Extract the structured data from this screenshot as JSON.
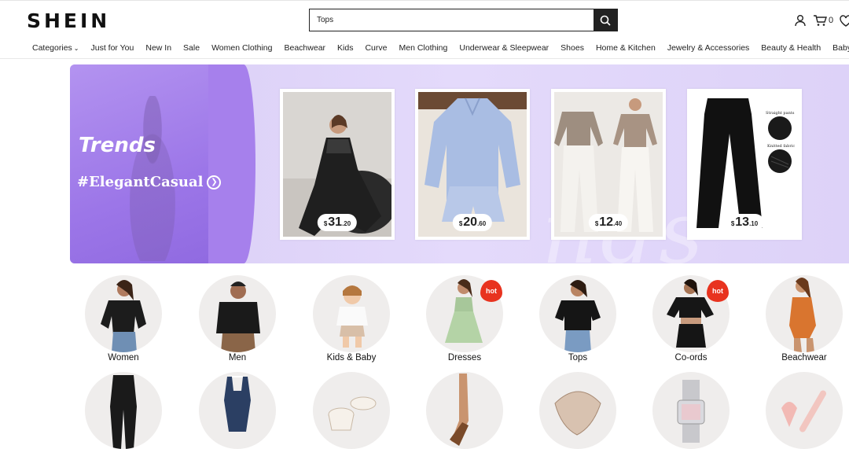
{
  "brand": {
    "logo": "SHEIN"
  },
  "search": {
    "value": "Tops"
  },
  "header": {
    "cart_count": "0"
  },
  "nav": {
    "items": [
      "Categories",
      "Just for You",
      "New In",
      "Sale",
      "Women Clothing",
      "Beachwear",
      "Kids",
      "Curve",
      "Men Clothing",
      "Underwear & Sleepwear",
      "Shoes",
      "Home & Kitchen",
      "Jewelry & Accessories",
      "Beauty & Health",
      "Baby & Matern"
    ]
  },
  "banner": {
    "title": "Trends",
    "tagline": "#ElegantCasual",
    "products": [
      {
        "currency": "$",
        "price_int": "31",
        "price_dec": ".20"
      },
      {
        "currency": "$",
        "price_int": "20",
        "price_dec": ".60"
      },
      {
        "currency": "$",
        "price_int": "12",
        "price_dec": ".40"
      },
      {
        "currency": "$",
        "price_int": "13",
        "price_dec": ".10",
        "notes": [
          "Straight pants",
          "Knitted fabric"
        ]
      }
    ]
  },
  "categories": {
    "row1": [
      {
        "label": "Women",
        "hot": false
      },
      {
        "label": "Men",
        "hot": false
      },
      {
        "label": "Kids & Baby",
        "hot": false
      },
      {
        "label": "Dresses",
        "hot": true
      },
      {
        "label": "Tops",
        "hot": false
      },
      {
        "label": "Co-ords",
        "hot": true
      },
      {
        "label": "Beachwear",
        "hot": false
      }
    ],
    "hot_label": "hot"
  },
  "colors": {
    "accent": "#9c76e8",
    "hot": "#e8331f",
    "dark": "#222222"
  }
}
